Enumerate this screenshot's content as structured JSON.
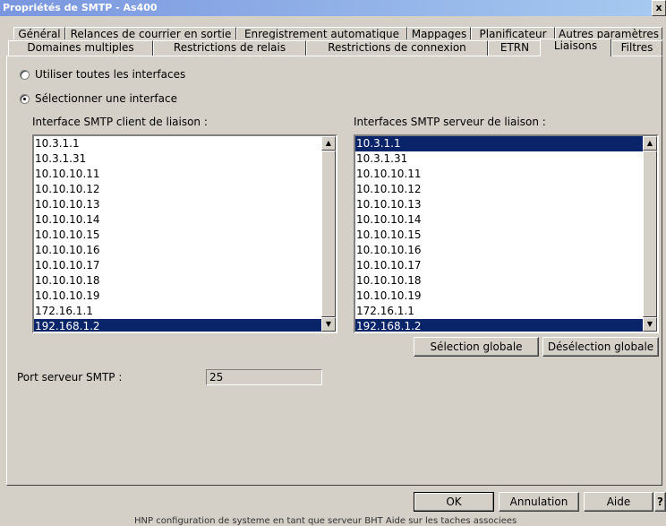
{
  "window": {
    "title": "Propriétés de SMTP - As400",
    "close_label": "x"
  },
  "tabs_back": [
    "Général",
    "Relances de courrier en sortie",
    "Enregistrement automatique",
    "Mappages",
    "Planificateur",
    "Autres paramètres"
  ],
  "tabs_front": [
    "Domaines multiples",
    "Restrictions de relais",
    "Restrictions de connexion",
    "ETRN",
    "Liaisons",
    "Filtres"
  ],
  "active_tab": "Liaisons",
  "options": {
    "all_interfaces": "Utiliser toutes les interfaces",
    "select_interface": "Sélectionner une interface",
    "selected": "select_interface"
  },
  "client_list": {
    "label": "Interface SMTP client de liaison :",
    "items": [
      "10.3.1.1",
      "10.3.1.31",
      "10.10.10.11",
      "10.10.10.12",
      "10.10.10.13",
      "10.10.10.14",
      "10.10.10.15",
      "10.10.10.16",
      "10.10.10.17",
      "10.10.10.18",
      "10.10.10.19",
      "172.16.1.1",
      "192.168.1.2"
    ],
    "selected": "192.168.1.2"
  },
  "server_list": {
    "label": "Interfaces SMTP serveur de liaison :",
    "items": [
      "10.3.1.1",
      "10.3.1.31",
      "10.10.10.11",
      "10.10.10.12",
      "10.10.10.13",
      "10.10.10.14",
      "10.10.10.15",
      "10.10.10.16",
      "10.10.10.17",
      "10.10.10.18",
      "10.10.10.19",
      "172.16.1.1",
      "192.168.1.2"
    ],
    "selected": [
      "10.3.1.1",
      "192.168.1.2"
    ]
  },
  "buttons": {
    "select_all": "Sélection globale",
    "deselect_all": "Désélection globale",
    "ok": "OK",
    "cancel": "Annulation",
    "help": "Aide",
    "question": "?"
  },
  "port": {
    "label": "Port serveur SMTP :",
    "value": "25"
  },
  "background_text": "HNP configuration de systeme en tant que serveur BHT      Aide sur les taches associees"
}
